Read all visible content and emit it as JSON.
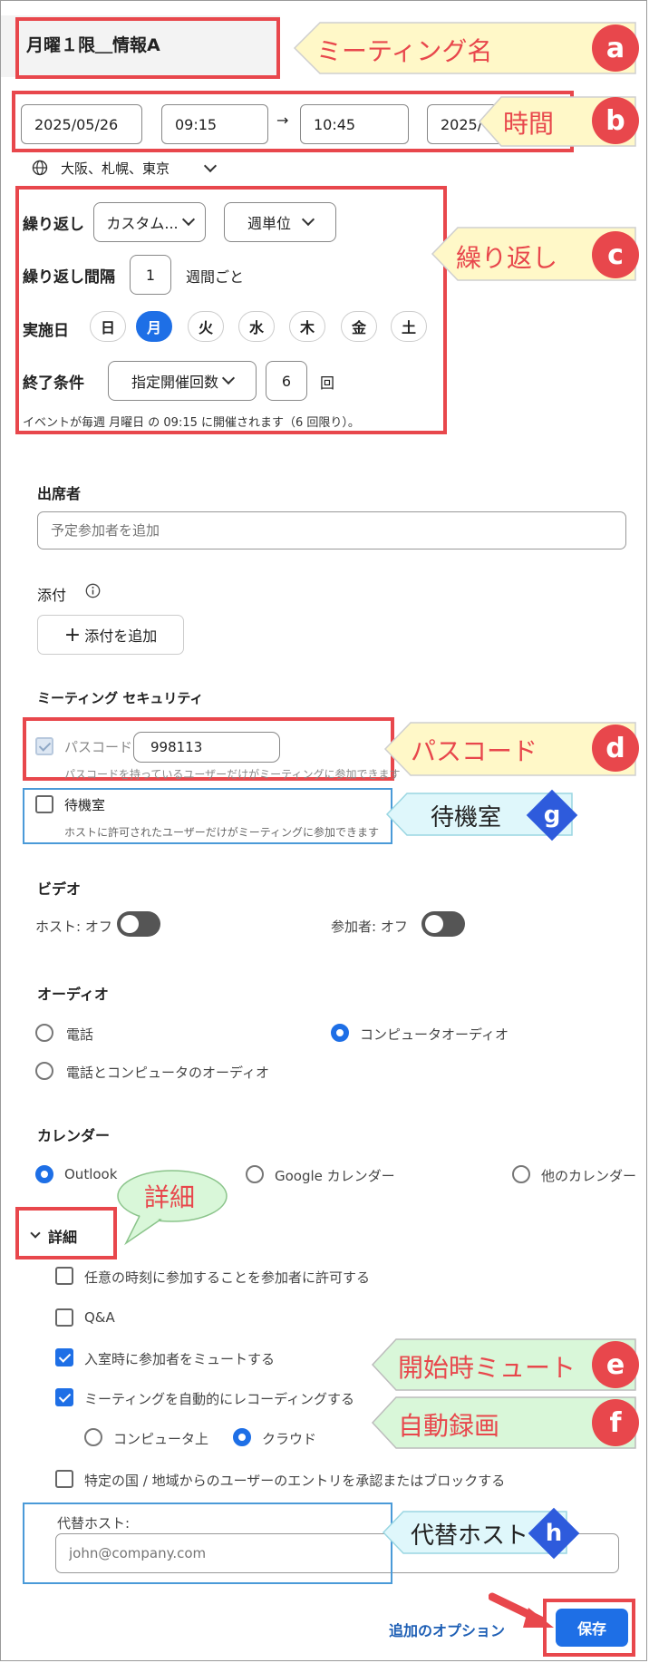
{
  "meeting_name": {
    "title": "月曜１限＿情報A"
  },
  "time": {
    "start_date": "2025/05/26",
    "start_time": "09:15",
    "arrow": "→",
    "end_time": "10:45",
    "end_date": "2025/",
    "timezone": "大阪、札幌、東京"
  },
  "recurrence": {
    "label": "繰り返し",
    "type_value": "カスタム...",
    "unit_value": "週単位",
    "interval_label": "繰り返し間隔",
    "interval_value": "1",
    "interval_unit": "週間ごと",
    "days_label": "実施日",
    "days": [
      {
        "label": "日",
        "selected": false
      },
      {
        "label": "月",
        "selected": true
      },
      {
        "label": "火",
        "selected": false
      },
      {
        "label": "水",
        "selected": false
      },
      {
        "label": "木",
        "selected": false
      },
      {
        "label": "金",
        "selected": false
      },
      {
        "label": "土",
        "selected": false
      }
    ],
    "end_label": "終了条件",
    "end_type": "指定開催回数",
    "end_count": "6",
    "end_unit": "回",
    "summary": "イベントが毎週 月曜日 の 09:15 に開催されます（6 回限り）。"
  },
  "attendees": {
    "label": "出席者",
    "placeholder": "予定参加者を追加"
  },
  "attachments": {
    "label": "添付",
    "add_button": "添付を追加"
  },
  "security": {
    "label": "ミーティング セキュリティ",
    "passcode_label": "パスコード",
    "passcode_value": "998113",
    "passcode_hint": "パスコードを持っているユーザーだけがミーティングに参加できます",
    "passcode_checked": true,
    "waiting_room_label": "待機室",
    "waiting_room_hint": "ホストに許可されたユーザーだけがミーティングに参加できます",
    "waiting_room_checked": false
  },
  "video": {
    "label": "ビデオ",
    "host_label": "ホスト:",
    "host_state": "オフ",
    "participant_label": "参加者:",
    "participant_state": "オフ"
  },
  "audio": {
    "label": "オーディオ",
    "options": [
      {
        "label": "電話",
        "selected": false
      },
      {
        "label": "コンピュータオーディオ",
        "selected": true
      },
      {
        "label": "電話とコンピュータのオーディオ",
        "selected": false
      }
    ]
  },
  "calendar": {
    "label": "カレンダー",
    "options": [
      {
        "label": "Outlook",
        "selected": true
      },
      {
        "label": "Google カレンダー",
        "selected": false
      },
      {
        "label": "他のカレンダー",
        "selected": false
      }
    ]
  },
  "details": {
    "label": "詳細",
    "options": [
      {
        "label": "任意の時刻に参加することを参加者に許可する",
        "checked": false
      },
      {
        "label": "Q&A",
        "checked": false
      },
      {
        "label": "入室時に参加者をミュートする",
        "checked": true
      },
      {
        "label": "ミーティングを自動的にレコーディングする",
        "checked": true
      }
    ],
    "recording_targets": [
      {
        "label": "コンピュータ上",
        "selected": false
      },
      {
        "label": "クラウド",
        "selected": true
      }
    ],
    "region_block_label": "特定の国 / 地域からのユーザーのエントリを承認またはブロックする",
    "region_block_checked": false,
    "alt_host_label": "代替ホスト:",
    "alt_host_placeholder": "john@company.com"
  },
  "footer": {
    "more_options": "追加のオプション",
    "save": "保存"
  },
  "annotations": {
    "a": {
      "text": "ミーティング名",
      "badge": "a"
    },
    "b": {
      "text": "時間",
      "badge": "b"
    },
    "c": {
      "text": "繰り返し",
      "badge": "c"
    },
    "d": {
      "text": "パスコード",
      "badge": "d"
    },
    "e": {
      "text": "開始時ミュート",
      "badge": "e"
    },
    "f": {
      "text": "自動録画",
      "badge": "f"
    },
    "g": {
      "text": "待機室",
      "badge": "g"
    },
    "h": {
      "text": "代替ホスト",
      "badge": "h"
    },
    "details_bubble": "詳細"
  },
  "colors": {
    "accent": "#1e6fe6",
    "annotation_red": "#e8474c",
    "callout_yellow": "#fff8c8",
    "callout_cyan": "#dff7fb",
    "callout_green": "#d9f7d9"
  }
}
